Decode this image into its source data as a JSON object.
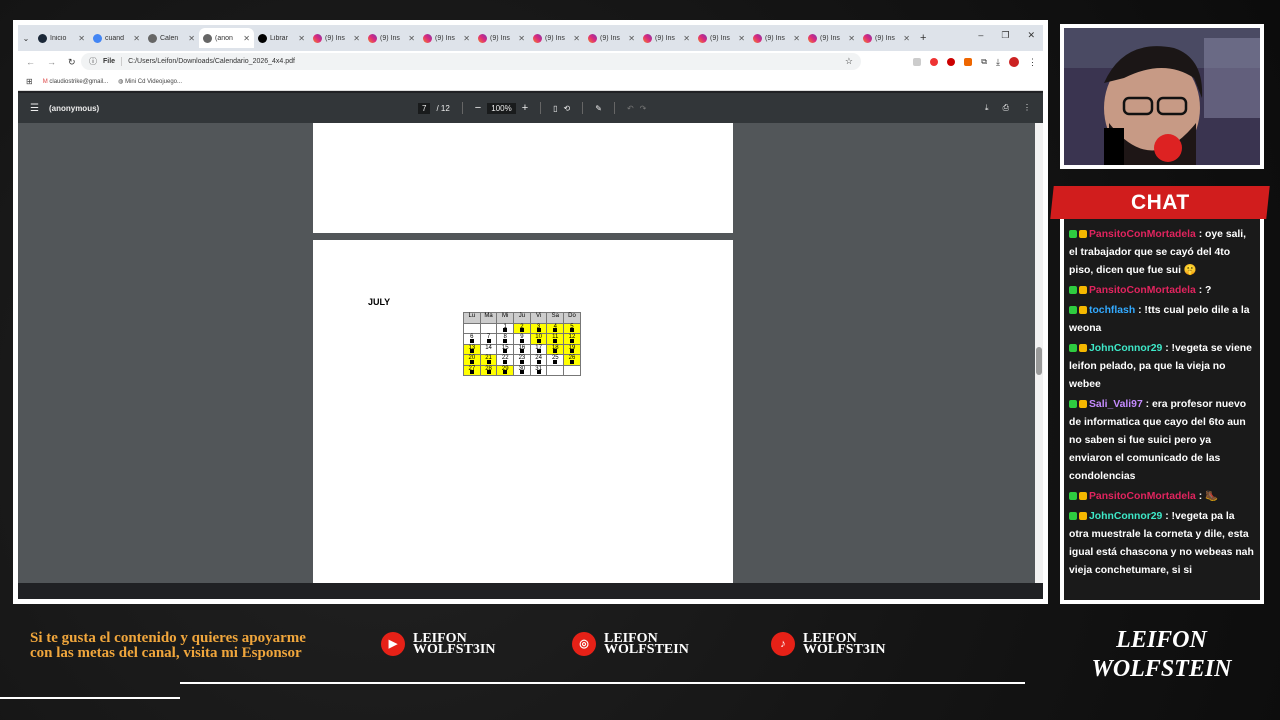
{
  "browser": {
    "tabs": [
      {
        "label": "Inicio",
        "icon": "steam-icon",
        "color": "#1b2838",
        "active": false
      },
      {
        "label": "cuand",
        "icon": "google-icon",
        "color": "#4285f4",
        "active": false
      },
      {
        "label": "Calen",
        "icon": "globe-icon",
        "color": "#666666",
        "active": false
      },
      {
        "label": "(anon",
        "icon": "globe-icon",
        "color": "#666666",
        "active": true
      },
      {
        "label": "Librar",
        "icon": "x-icon",
        "color": "#000000",
        "active": false
      },
      {
        "label": "(9) Ins",
        "icon": "instagram-icon",
        "color": "#dd2a7b",
        "active": false
      },
      {
        "label": "(9) Ins",
        "icon": "instagram-icon",
        "color": "#dd2a7b",
        "active": false
      },
      {
        "label": "(9) Ins",
        "icon": "instagram-icon",
        "color": "#dd2a7b",
        "active": false
      },
      {
        "label": "(9) Ins",
        "icon": "instagram-icon",
        "color": "#dd2a7b",
        "active": false
      },
      {
        "label": "(9) Ins",
        "icon": "instagram-icon",
        "color": "#dd2a7b",
        "active": false
      },
      {
        "label": "(9) Ins",
        "icon": "instagram-icon",
        "color": "#dd2a7b",
        "active": false
      },
      {
        "label": "(9) Ins",
        "icon": "instagram-icon",
        "color": "#dd2a7b",
        "active": false
      },
      {
        "label": "(9) Ins",
        "icon": "instagram-icon",
        "color": "#dd2a7b",
        "active": false
      },
      {
        "label": "(9) Ins",
        "icon": "instagram-icon",
        "color": "#dd2a7b",
        "active": false
      },
      {
        "label": "(9) Ins",
        "icon": "instagram-icon",
        "color": "#dd2a7b",
        "active": false
      },
      {
        "label": "(9) Ins",
        "icon": "instagram-icon",
        "color": "#dd2a7b",
        "active": false
      }
    ],
    "address_scheme": "File",
    "address": "C:/Users/Leifon/Downloads/Calendario_2026_4x4.pdf",
    "bookmarks": [
      "claudiostrike@gmail...",
      "Mini Cd Videojuego..."
    ]
  },
  "pdf": {
    "title": "(anonymous)",
    "page_current": "7",
    "page_total": "/ 12",
    "zoom": "100%"
  },
  "calendar": {
    "month": "JULY",
    "headers": [
      "Lu",
      "Ma",
      "Mi",
      "Ju",
      "Vi",
      "Sa",
      "Do"
    ],
    "weeks": [
      [
        {
          "d": "",
          "y": false,
          "m": false
        },
        {
          "d": "",
          "y": false,
          "m": false
        },
        {
          "d": "1",
          "y": false,
          "m": true
        },
        {
          "d": "2",
          "y": true,
          "m": true
        },
        {
          "d": "3",
          "y": true,
          "m": true
        },
        {
          "d": "4",
          "y": true,
          "m": true
        },
        {
          "d": "5",
          "y": true,
          "m": true
        }
      ],
      [
        {
          "d": "6",
          "y": false,
          "m": true
        },
        {
          "d": "7",
          "y": false,
          "m": true
        },
        {
          "d": "8",
          "y": false,
          "m": true
        },
        {
          "d": "9",
          "y": false,
          "m": true
        },
        {
          "d": "10",
          "y": true,
          "m": true
        },
        {
          "d": "11",
          "y": true,
          "m": true
        },
        {
          "d": "12",
          "y": true,
          "m": true
        }
      ],
      [
        {
          "d": "13",
          "y": true,
          "m": true
        },
        {
          "d": "14",
          "y": false,
          "m": false
        },
        {
          "d": "15",
          "y": false,
          "m": true
        },
        {
          "d": "16",
          "y": false,
          "m": true
        },
        {
          "d": "17",
          "y": false,
          "m": true
        },
        {
          "d": "18",
          "y": true,
          "m": true
        },
        {
          "d": "19",
          "y": true,
          "m": true
        }
      ],
      [
        {
          "d": "20",
          "y": true,
          "m": true
        },
        {
          "d": "21",
          "y": true,
          "m": true
        },
        {
          "d": "22",
          "y": false,
          "m": true
        },
        {
          "d": "23",
          "y": false,
          "m": true
        },
        {
          "d": "24",
          "y": false,
          "m": true
        },
        {
          "d": "25",
          "y": false,
          "m": true
        },
        {
          "d": "26",
          "y": true,
          "m": true
        }
      ],
      [
        {
          "d": "27",
          "y": true,
          "m": true
        },
        {
          "d": "28",
          "y": true,
          "m": true
        },
        {
          "d": "29",
          "y": true,
          "m": true
        },
        {
          "d": "30",
          "y": false,
          "m": true
        },
        {
          "d": "31",
          "y": false,
          "m": true
        },
        {
          "d": "",
          "y": false,
          "m": false
        },
        {
          "d": "",
          "y": false,
          "m": false
        }
      ]
    ]
  },
  "chat": {
    "title": "CHAT",
    "messages": [
      {
        "user": "PansitoConMortadela",
        "color": "#e0245e",
        "text": " : oye sali, el trabajador que se cayó del 4to piso, dicen que fue sui 🤫"
      },
      {
        "user": "PansitoConMortadela",
        "color": "#e0245e",
        "text": " : ?"
      },
      {
        "user": "tochflash",
        "color": "#33aaff",
        "text": " : !tts cual pelo dile a la weona"
      },
      {
        "user": "JohnConnor29",
        "color": "#3ee8c8",
        "text": " : !vegeta se viene leifon pelado, pa que la vieja no webee"
      },
      {
        "user": "Sali_Vali97",
        "color": "#c58bff",
        "text": " : era profesor nuevo de informatica que cayo del 6to aun no saben si fue suici pero ya enviaron el comunicado de las condolencias"
      },
      {
        "user": "PansitoConMortadela",
        "color": "#e0245e",
        "text": " : 🥾"
      },
      {
        "user": "JohnConnor29",
        "color": "#3ee8c8",
        "text": " : !vegeta pa la otra muestrale la corneta y dile, esta igual está chascona y no webeas nah vieja conchetumare, si si"
      }
    ]
  },
  "footer": {
    "sponsor_text": "Si te gusta el contenido y quieres apoyarme con las metas del canal, visita mi Esponsor",
    "youtube": "LEIFON WOLFST3IN",
    "instagram": "LEIFON WOLFSTEIN",
    "tiktok": "LEIFON WOLFST3IN",
    "logo_top": "LEIFON",
    "logo_bottom": "WOLFSTEIN"
  }
}
